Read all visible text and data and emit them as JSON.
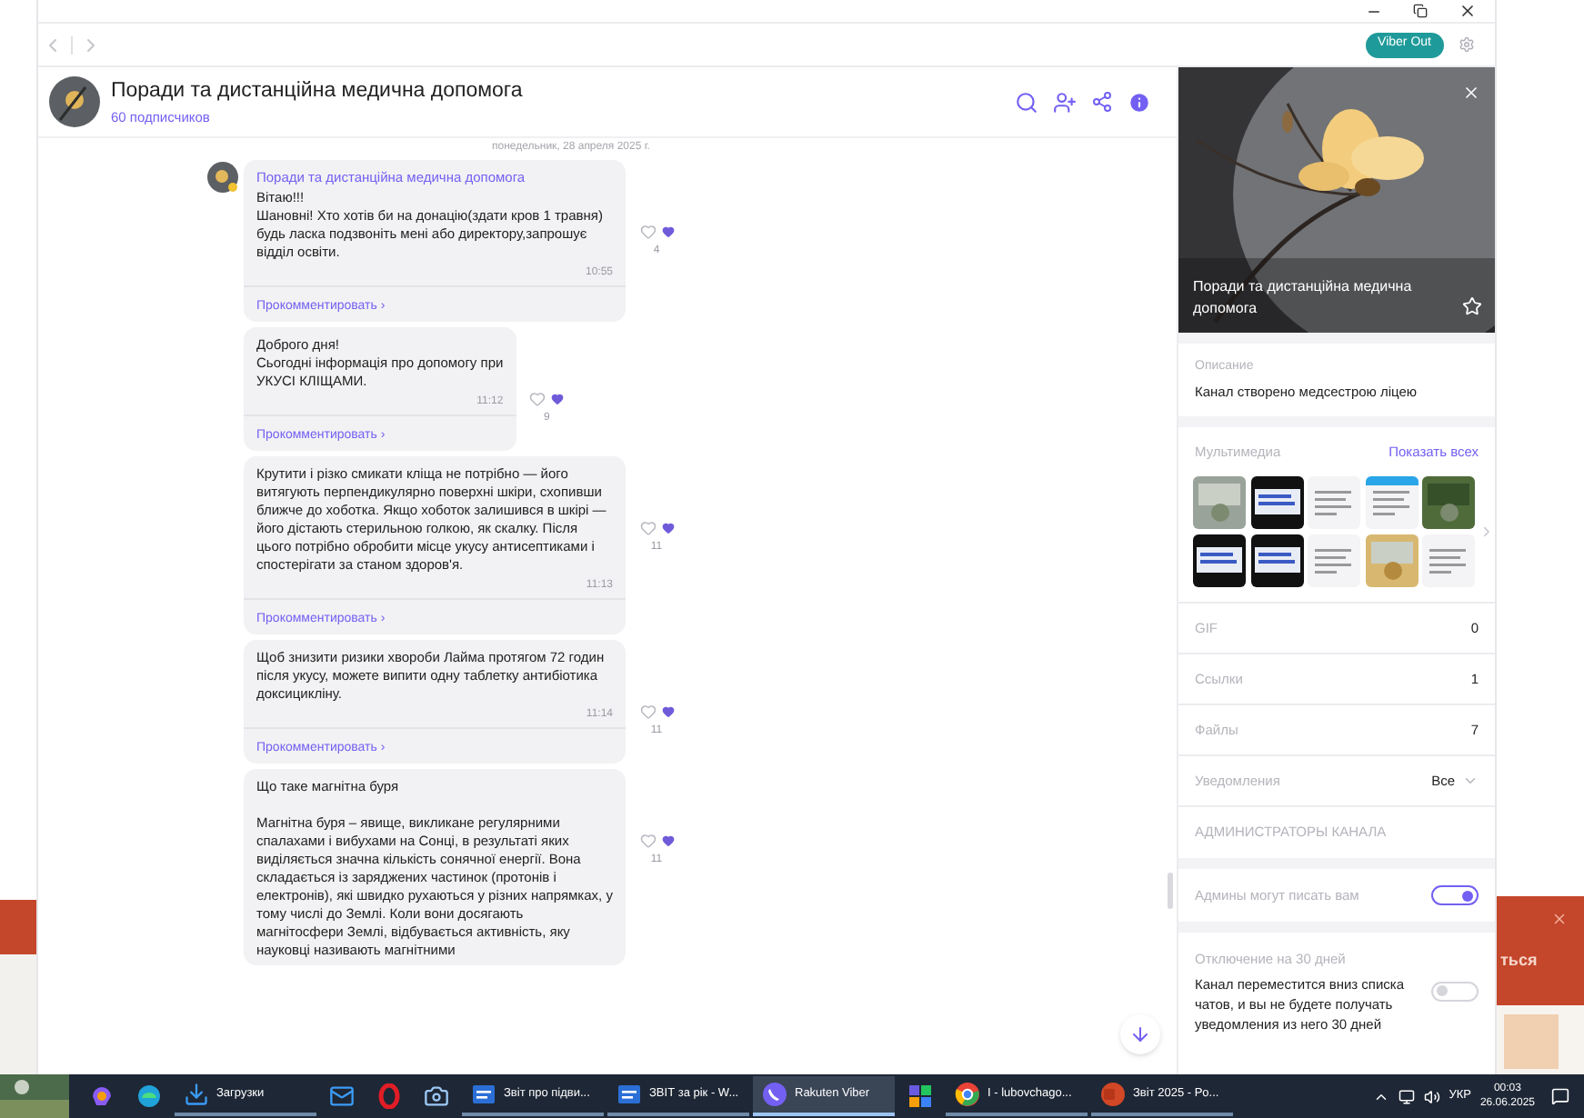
{
  "toolbar": {
    "viber_out": "Viber Out"
  },
  "channel": {
    "title": "Поради та дистанційна медична допомога",
    "subscribers": "60 подписчиков"
  },
  "date_divider": "понедельник, 28 апреля 2025 г.",
  "messages": [
    {
      "sender": "Поради та дистанційна медична допомога",
      "text": "Вітаю!!!\nШановні! Хто хотів би на донацію(здати кров 1 травня) будь ласка подзвоніть мені або директору,запрошує відділ  освіти.",
      "time": "10:55",
      "likes": "4",
      "comment": "Прокомментировать ›"
    },
    {
      "text": "Доброго дня!\nСьогодні інформація про допомогу при\n УКУСІ КЛІЩАМИ.",
      "time": "11:12",
      "likes": "9",
      "comment": "Прокомментировать ›"
    },
    {
      "text": "Крутити і різко смикати кліща не потрібно — його витягують перпендикулярно поверхні шкіри, схопивши ближче до хоботка. Якщо хоботок залишився в шкірі — його дістають стерильною голкою, як скалку. Після цього потрібно обробити місце укусу антисептиками і спостерігати за станом здоров'я.",
      "time": "11:13",
      "likes": "11",
      "comment": "Прокомментировать ›"
    },
    {
      "text": "Щоб знизити ризики хвороби Лайма протягом 72 годин після укусу, можете випити одну таблетку антибіотика доксицикліну.",
      "time": "11:14",
      "likes": "11",
      "comment": "Прокомментировать ›"
    },
    {
      "text": "Що таке магнітна буря\n\nМагнітна буря – явище, викликане регулярними спалахами і вибухами на Сонці, в результаті яких виділяється значна кількість сонячної енергії. Вона складається із заряджених частинок (протонів і електронів), які швидко рухаються у різних напрямках, у тому числі до Землі. Коли вони досягають магнітосфери Землі, відбувається активність, яку науковці називають магнітними",
      "likes": "11"
    }
  ],
  "info_panel": {
    "title": "Поради та дистанційна медична допомога",
    "description_label": "Описание",
    "description": "Канал створено медсестрою ліцею",
    "media_label": "Мультимедиа",
    "show_all": "Показать всех",
    "counts": [
      {
        "label": "GIF",
        "value": "0"
      },
      {
        "label": "Ссылки",
        "value": "1"
      },
      {
        "label": "Файлы",
        "value": "7"
      }
    ],
    "notifications": {
      "label": "Уведомления",
      "value": "Все"
    },
    "admins_heading": "АДМИНИСТРАТОРЫ КАНАЛА",
    "toggles": [
      {
        "label": "Админы могут писать вам",
        "on": true
      },
      {
        "label": "Отключение на 30 дней",
        "description": "Канал переместится вниз списка чатов, и вы не будете получать уведомления из него 30 дней",
        "on": false
      }
    ]
  },
  "background_window": {
    "text": "ться"
  },
  "taskbar": {
    "items": [
      {
        "kind": "swirl"
      },
      {
        "kind": "wave"
      },
      {
        "kind": "download",
        "label": "Загрузки",
        "selected": false
      },
      {
        "kind": "mail"
      },
      {
        "kind": "ring"
      },
      {
        "kind": "camera"
      },
      {
        "kind": "document",
        "label": "Звіт про підви...",
        "selected": false
      },
      {
        "kind": "document",
        "label": "ЗВІТ за рік - W...",
        "selected": false
      },
      {
        "kind": "phone",
        "label": "Rakuten Viber",
        "selected": true
      },
      {
        "kind": "grid"
      },
      {
        "kind": "globe",
        "label": "I - lubovchago...",
        "selected": false
      },
      {
        "kind": "slides",
        "label": "Звіт 2025 - Po...",
        "selected": false
      }
    ],
    "language": "УКР",
    "time": "00:03",
    "date": "26.06.2025"
  }
}
